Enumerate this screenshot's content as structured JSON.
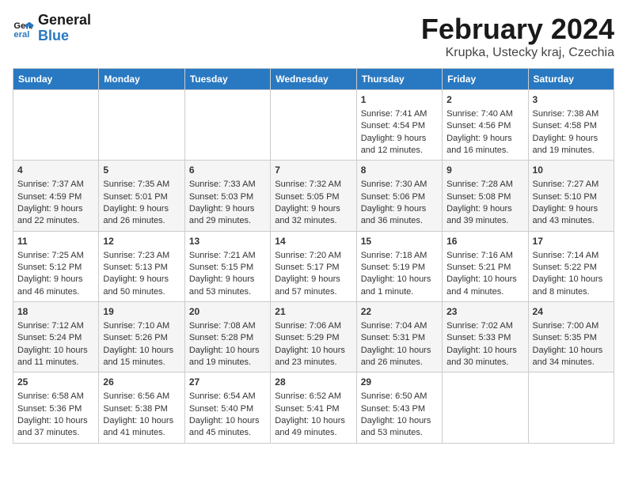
{
  "logo": {
    "line1": "General",
    "line2": "Blue"
  },
  "title": "February 2024",
  "subtitle": "Krupka, Ustecky kraj, Czechia",
  "days_of_week": [
    "Sunday",
    "Monday",
    "Tuesday",
    "Wednesday",
    "Thursday",
    "Friday",
    "Saturday"
  ],
  "weeks": [
    [
      {
        "day": "",
        "content": ""
      },
      {
        "day": "",
        "content": ""
      },
      {
        "day": "",
        "content": ""
      },
      {
        "day": "",
        "content": ""
      },
      {
        "day": "1",
        "content": "Sunrise: 7:41 AM\nSunset: 4:54 PM\nDaylight: 9 hours\nand 12 minutes."
      },
      {
        "day": "2",
        "content": "Sunrise: 7:40 AM\nSunset: 4:56 PM\nDaylight: 9 hours\nand 16 minutes."
      },
      {
        "day": "3",
        "content": "Sunrise: 7:38 AM\nSunset: 4:58 PM\nDaylight: 9 hours\nand 19 minutes."
      }
    ],
    [
      {
        "day": "4",
        "content": "Sunrise: 7:37 AM\nSunset: 4:59 PM\nDaylight: 9 hours\nand 22 minutes."
      },
      {
        "day": "5",
        "content": "Sunrise: 7:35 AM\nSunset: 5:01 PM\nDaylight: 9 hours\nand 26 minutes."
      },
      {
        "day": "6",
        "content": "Sunrise: 7:33 AM\nSunset: 5:03 PM\nDaylight: 9 hours\nand 29 minutes."
      },
      {
        "day": "7",
        "content": "Sunrise: 7:32 AM\nSunset: 5:05 PM\nDaylight: 9 hours\nand 32 minutes."
      },
      {
        "day": "8",
        "content": "Sunrise: 7:30 AM\nSunset: 5:06 PM\nDaylight: 9 hours\nand 36 minutes."
      },
      {
        "day": "9",
        "content": "Sunrise: 7:28 AM\nSunset: 5:08 PM\nDaylight: 9 hours\nand 39 minutes."
      },
      {
        "day": "10",
        "content": "Sunrise: 7:27 AM\nSunset: 5:10 PM\nDaylight: 9 hours\nand 43 minutes."
      }
    ],
    [
      {
        "day": "11",
        "content": "Sunrise: 7:25 AM\nSunset: 5:12 PM\nDaylight: 9 hours\nand 46 minutes."
      },
      {
        "day": "12",
        "content": "Sunrise: 7:23 AM\nSunset: 5:13 PM\nDaylight: 9 hours\nand 50 minutes."
      },
      {
        "day": "13",
        "content": "Sunrise: 7:21 AM\nSunset: 5:15 PM\nDaylight: 9 hours\nand 53 minutes."
      },
      {
        "day": "14",
        "content": "Sunrise: 7:20 AM\nSunset: 5:17 PM\nDaylight: 9 hours\nand 57 minutes."
      },
      {
        "day": "15",
        "content": "Sunrise: 7:18 AM\nSunset: 5:19 PM\nDaylight: 10 hours\nand 1 minute."
      },
      {
        "day": "16",
        "content": "Sunrise: 7:16 AM\nSunset: 5:21 PM\nDaylight: 10 hours\nand 4 minutes."
      },
      {
        "day": "17",
        "content": "Sunrise: 7:14 AM\nSunset: 5:22 PM\nDaylight: 10 hours\nand 8 minutes."
      }
    ],
    [
      {
        "day": "18",
        "content": "Sunrise: 7:12 AM\nSunset: 5:24 PM\nDaylight: 10 hours\nand 11 minutes."
      },
      {
        "day": "19",
        "content": "Sunrise: 7:10 AM\nSunset: 5:26 PM\nDaylight: 10 hours\nand 15 minutes."
      },
      {
        "day": "20",
        "content": "Sunrise: 7:08 AM\nSunset: 5:28 PM\nDaylight: 10 hours\nand 19 minutes."
      },
      {
        "day": "21",
        "content": "Sunrise: 7:06 AM\nSunset: 5:29 PM\nDaylight: 10 hours\nand 23 minutes."
      },
      {
        "day": "22",
        "content": "Sunrise: 7:04 AM\nSunset: 5:31 PM\nDaylight: 10 hours\nand 26 minutes."
      },
      {
        "day": "23",
        "content": "Sunrise: 7:02 AM\nSunset: 5:33 PM\nDaylight: 10 hours\nand 30 minutes."
      },
      {
        "day": "24",
        "content": "Sunrise: 7:00 AM\nSunset: 5:35 PM\nDaylight: 10 hours\nand 34 minutes."
      }
    ],
    [
      {
        "day": "25",
        "content": "Sunrise: 6:58 AM\nSunset: 5:36 PM\nDaylight: 10 hours\nand 37 minutes."
      },
      {
        "day": "26",
        "content": "Sunrise: 6:56 AM\nSunset: 5:38 PM\nDaylight: 10 hours\nand 41 minutes."
      },
      {
        "day": "27",
        "content": "Sunrise: 6:54 AM\nSunset: 5:40 PM\nDaylight: 10 hours\nand 45 minutes."
      },
      {
        "day": "28",
        "content": "Sunrise: 6:52 AM\nSunset: 5:41 PM\nDaylight: 10 hours\nand 49 minutes."
      },
      {
        "day": "29",
        "content": "Sunrise: 6:50 AM\nSunset: 5:43 PM\nDaylight: 10 hours\nand 53 minutes."
      },
      {
        "day": "",
        "content": ""
      },
      {
        "day": "",
        "content": ""
      }
    ]
  ]
}
